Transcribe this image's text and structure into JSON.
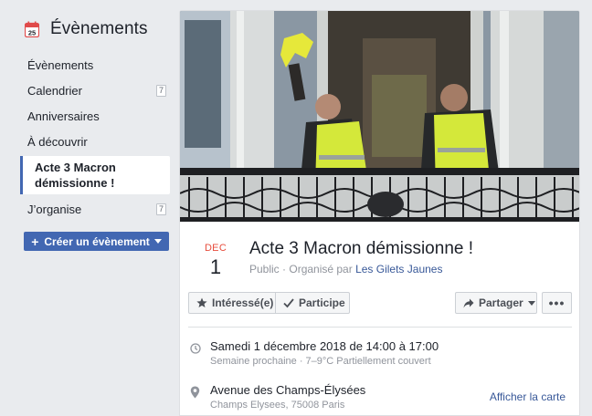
{
  "sidebar": {
    "title": "Évènements",
    "icon": "calendar-icon",
    "items": [
      {
        "label": "Évènements",
        "badge": ""
      },
      {
        "label": "Calendrier",
        "badge": "7"
      },
      {
        "label": "Anniversaires",
        "badge": ""
      },
      {
        "label": "À découvrir",
        "badge": ""
      },
      {
        "label_line1": "Acte 3 Macron",
        "label_line2": "démissionne !",
        "active": true
      },
      {
        "label": "J’organise",
        "badge": "7"
      }
    ],
    "create_button": "Créer un évènement"
  },
  "event": {
    "month": "DEC",
    "day": "1",
    "title": "Acte 3 Macron démissionne !",
    "privacy": "Public",
    "organized_by": "· Organisé par",
    "organizer": "Les Gilets Jaunes",
    "buttons": {
      "interested": "Intéressé(e)",
      "going": "Participe",
      "share": "Partager",
      "more": "•••"
    },
    "time": {
      "main": "Samedi 1 décembre 2018 de 14:00 à 17:00",
      "sub": "Semaine prochaine · 7–9°C Partiellement couvert"
    },
    "place": {
      "main": "Avenue des Champs-Élysées",
      "sub": "Champs Elysees, 75008 Paris",
      "map_link": "Afficher la carte"
    }
  },
  "colors": {
    "accent": "#4267b2",
    "link": "#385898",
    "month": "#e74c3c",
    "vest": "#d4e83a"
  }
}
